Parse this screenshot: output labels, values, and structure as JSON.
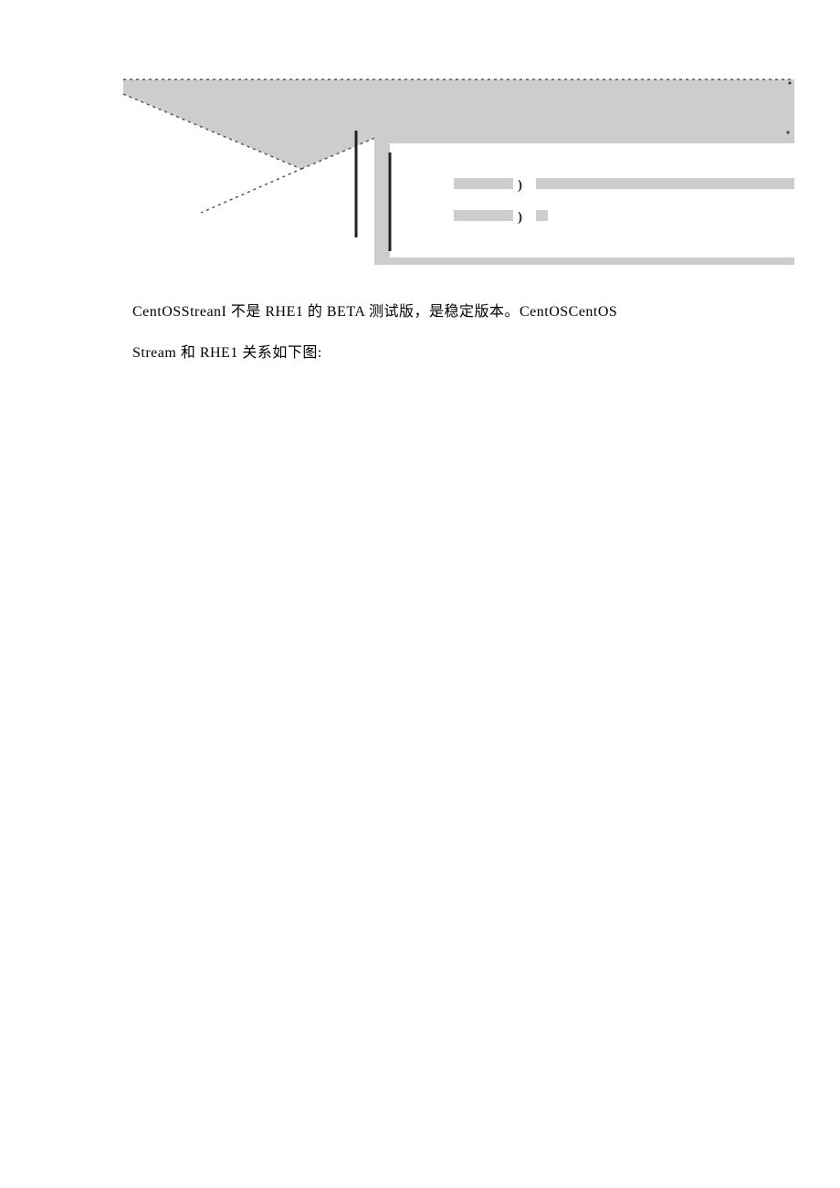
{
  "text": {
    "line1": "CentOSStreanI 不是 RHE1 的 BETA 测试版，是稳定版本。CentOSCentOS",
    "line2": "Stream 和 RHE1 关系如下图:"
  },
  "diagram": {
    "colors": {
      "fill": "#cdcdcd",
      "stroke": "#444444",
      "bracket": "#222222"
    }
  }
}
